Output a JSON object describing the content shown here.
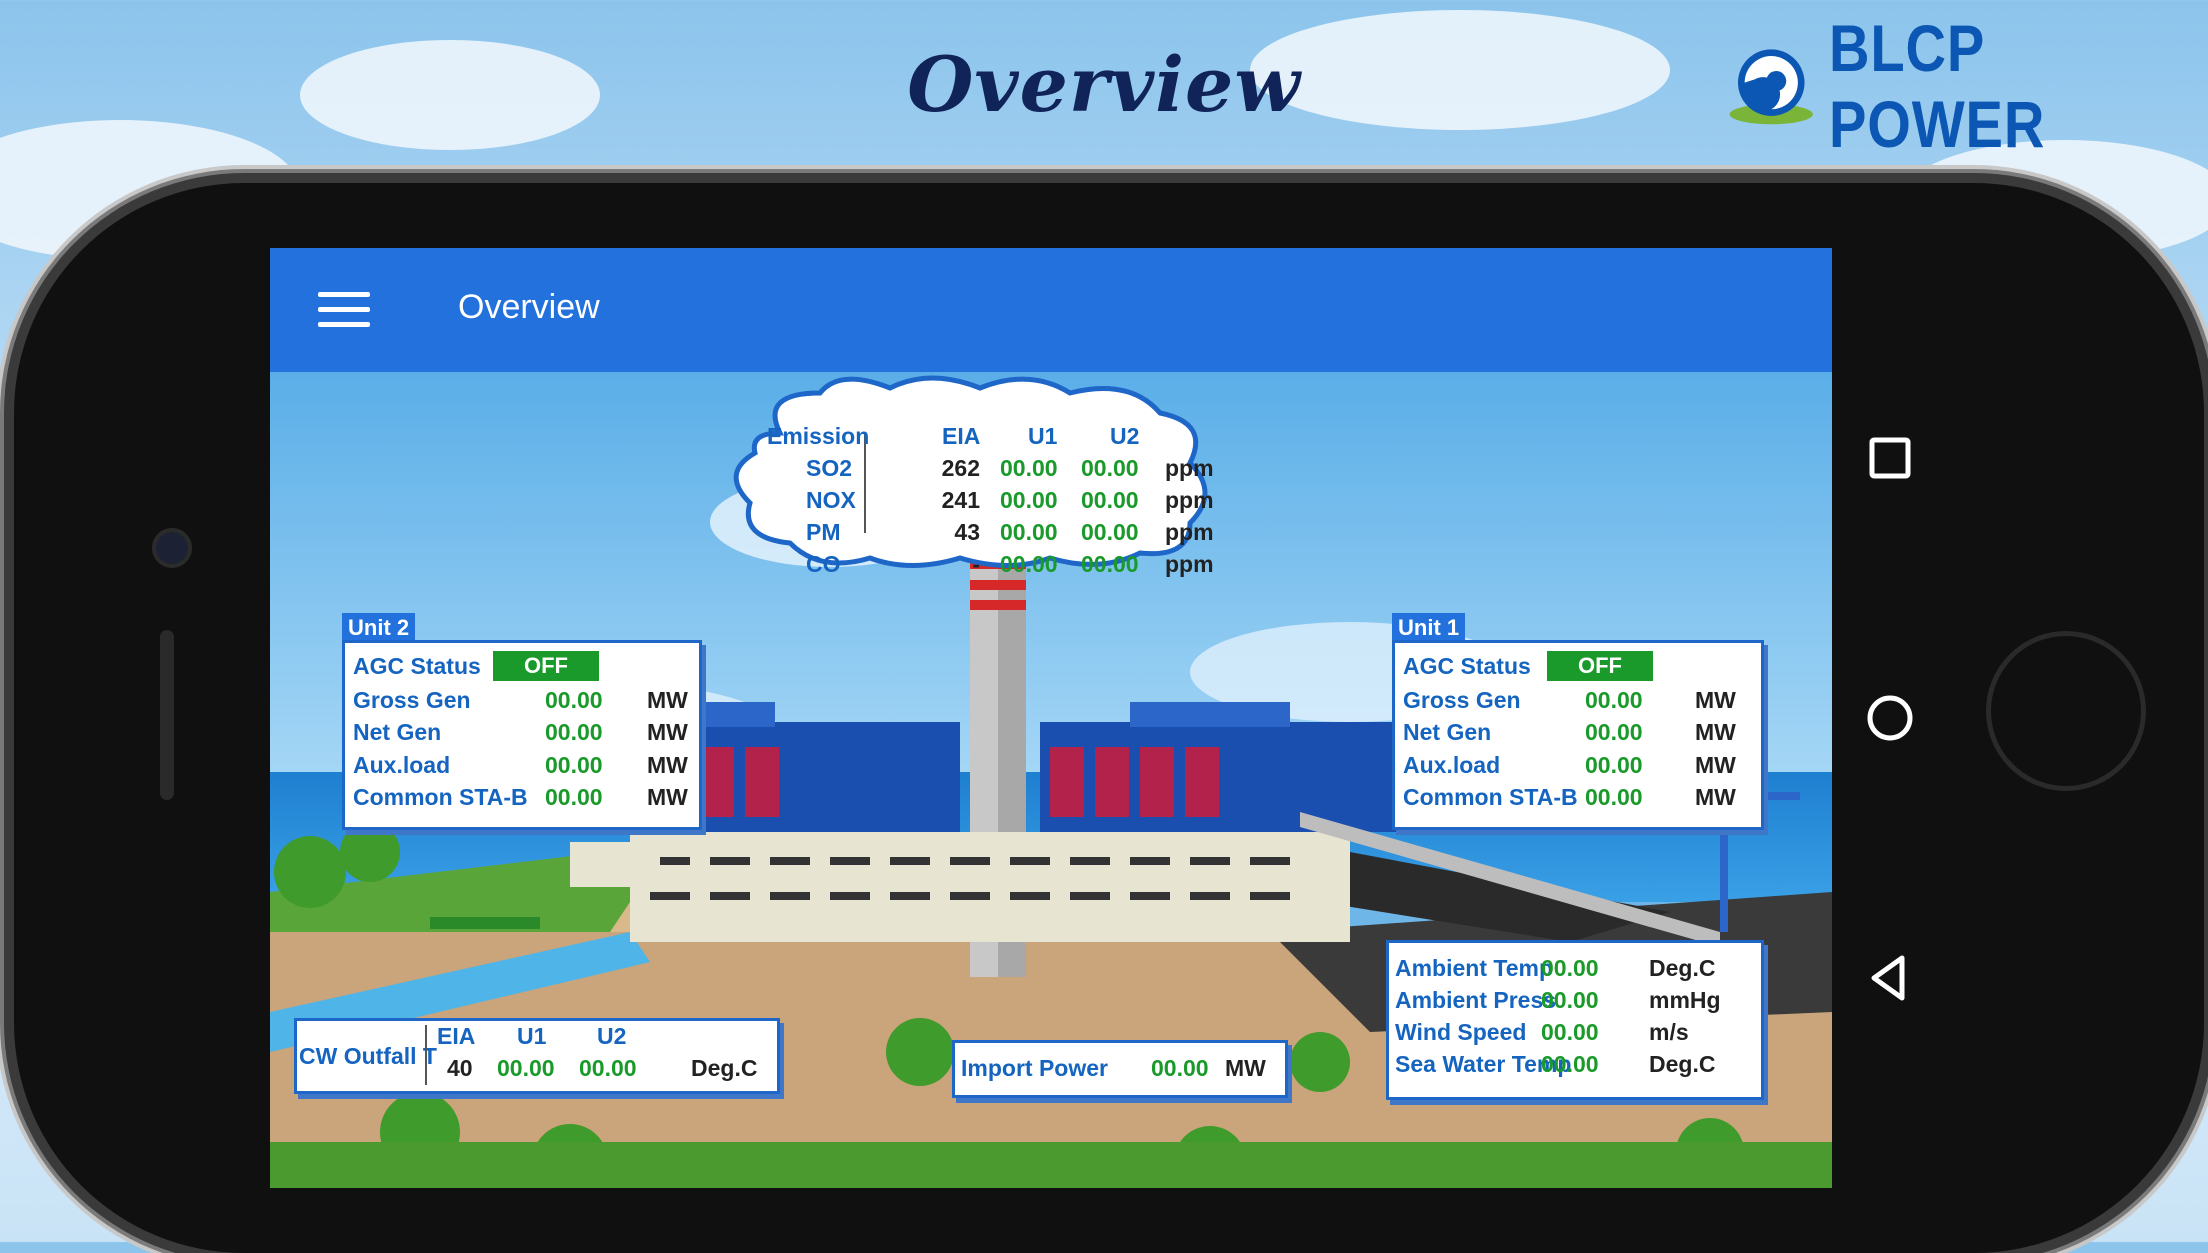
{
  "headline": "Overview",
  "brand": {
    "name": "BLCP POWER",
    "accent": "#0b57b3"
  },
  "app": {
    "title": "Overview",
    "bar_color": "#2271dc",
    "menu_icon": "hamburger-icon"
  },
  "emission": {
    "heading": "Emission",
    "cols": [
      "EIA",
      "U1",
      "U2"
    ],
    "rows": [
      {
        "name": "SO2",
        "eia": "262",
        "u1": "00.00",
        "u2": "00.00",
        "unit": "ppm"
      },
      {
        "name": "NOX",
        "eia": "241",
        "u1": "00.00",
        "u2": "00.00",
        "unit": "ppm"
      },
      {
        "name": "PM",
        "eia": "43",
        "u1": "00.00",
        "u2": "00.00",
        "unit": "ppm"
      },
      {
        "name": "CO",
        "eia": "-",
        "u1": "00.00",
        "u2": "00.00",
        "unit": "ppm"
      }
    ]
  },
  "unit2": {
    "title": "Unit 2",
    "agc_label": "AGC Status",
    "agc_value": "OFF",
    "rows": [
      {
        "label": "Gross Gen",
        "value": "00.00",
        "unit": "MW"
      },
      {
        "label": "Net Gen",
        "value": "00.00",
        "unit": "MW"
      },
      {
        "label": "Aux.load",
        "value": "00.00",
        "unit": "MW"
      },
      {
        "label": "Common STA-B",
        "value": "00.00",
        "unit": "MW"
      }
    ]
  },
  "unit1": {
    "title": "Unit 1",
    "agc_label": "AGC Status",
    "agc_value": "OFF",
    "rows": [
      {
        "label": "Gross Gen",
        "value": "00.00",
        "unit": "MW"
      },
      {
        "label": "Net Gen",
        "value": "00.00",
        "unit": "MW"
      },
      {
        "label": "Aux.load",
        "value": "00.00",
        "unit": "MW"
      },
      {
        "label": "Common STA-B",
        "value": "00.00",
        "unit": "MW"
      }
    ]
  },
  "weather": {
    "rows": [
      {
        "label": "Ambient Temp",
        "value": "00.00",
        "unit": "Deg.C"
      },
      {
        "label": "Ambient Press",
        "value": "00.00",
        "unit": "mmHg"
      },
      {
        "label": "Wind Speed",
        "value": "00.00",
        "unit": "m/s"
      },
      {
        "label": "Sea Water Temp",
        "value": "00.00",
        "unit": "Deg.C"
      }
    ]
  },
  "cw_outfall": {
    "label": "CW Outfall T",
    "cols": [
      "EIA",
      "U1",
      "U2"
    ],
    "eia": "40",
    "u1": "00.00",
    "u2": "00.00",
    "unit": "Deg.C"
  },
  "import_power": {
    "label": "Import Power",
    "value": "00.00",
    "unit": "MW"
  },
  "android_nav": [
    "recents-icon",
    "home-icon",
    "back-icon"
  ]
}
